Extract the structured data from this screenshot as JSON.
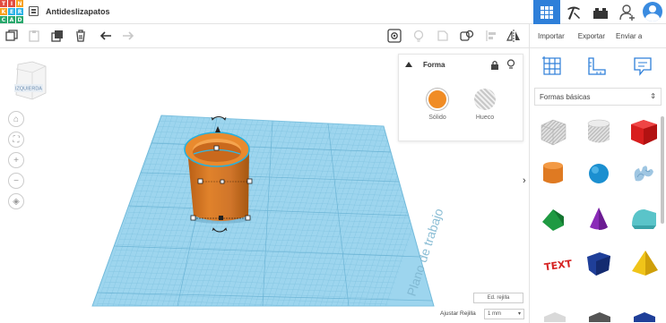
{
  "app": {
    "logo_letters": [
      "T",
      "I",
      "N",
      "K",
      "E",
      "R",
      "C",
      "A",
      "D"
    ],
    "logo_colors": [
      "#e24c3f",
      "#e24c3f",
      "#f9a11b",
      "#f9a11b",
      "#2db2e5",
      "#2db2e5",
      "#28a86c",
      "#28a86c",
      "#28a86c"
    ],
    "title": "Antideslizapatos",
    "accent": "#2e7fd9"
  },
  "header": {
    "icons": [
      "grid-view-icon",
      "build-pickaxe-icon",
      "bricks-icon",
      "add-user-icon",
      "account-avatar-icon"
    ]
  },
  "toolbar": {
    "tools": [
      "copy-icon",
      "paste-icon",
      "duplicate-icon",
      "delete-icon",
      "undo-icon",
      "redo-icon",
      "view-eye-icon",
      "light-bulb-icon",
      "group-icon",
      "ungroup-icon",
      "align-icon",
      "mirror-icon"
    ]
  },
  "right_panel": {
    "tabs": [
      "Importar",
      "Exportar",
      "Enviar a"
    ],
    "category": "Formas básicas",
    "view_icons": [
      "workplane-grid-icon",
      "ruler-icon",
      "notes-icon"
    ],
    "shapes": [
      "box-hole-shape",
      "cylinder-hole-shape",
      "box-shape",
      "cylinder-shape",
      "sphere-shape",
      "scribble-shape",
      "roof-shape",
      "cone-shape",
      "round-roof-shape",
      "text-shape",
      "wedge-shape",
      "pyramid-shape"
    ]
  },
  "shape_panel": {
    "title": "Forma",
    "solid_label": "Sólido",
    "hole_label": "Hueco",
    "solid_color": "#f08c25"
  },
  "viewcube": {
    "face_label": "IZQUIERDA"
  },
  "workplane": {
    "label": "Plano de trabajo",
    "color": "#8fd0ec"
  },
  "bottom": {
    "edit_grid": "Ed. rejilla",
    "snap_label": "Ajustar Rejilla",
    "snap_value": "1 mm"
  }
}
